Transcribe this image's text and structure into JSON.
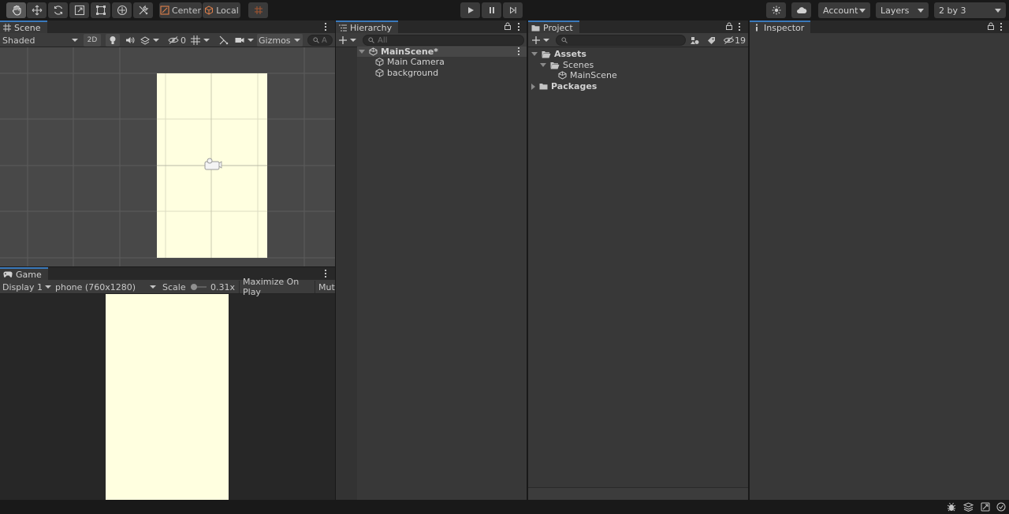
{
  "toolbar": {
    "pivot_label": "Center",
    "space_label": "Local",
    "account_label": "Account",
    "layers_label": "Layers",
    "layout_label": "2 by 3"
  },
  "scene": {
    "tab_label": "Scene",
    "shading_mode": "Shaded",
    "mode_2d_label": "2D",
    "hidden_count": "0",
    "gizmos_label": "Gizmos",
    "search_placeholder": "A"
  },
  "game": {
    "tab_label": "Game",
    "display_label": "Display 1",
    "resolution_label": "phone (760x1280)",
    "scale_label": "Scale",
    "scale_value": "0.31x",
    "maximize_label": "Maximize On Play",
    "mute_label": "Mute"
  },
  "hierarchy": {
    "tab_label": "Hierarchy",
    "search_placeholder": "All",
    "scene_name": "MainScene*",
    "items": [
      {
        "label": "Main Camera"
      },
      {
        "label": "background"
      }
    ]
  },
  "project": {
    "tab_label": "Project",
    "hidden_packages_count": "19",
    "tree": {
      "assets": "Assets",
      "scenes": "Scenes",
      "main_scene": "MainScene",
      "packages": "Packages"
    }
  },
  "inspector": {
    "tab_label": "Inspector"
  },
  "colors": {
    "camera_background": "#ffffe0",
    "tab_accent": "#3a79bb",
    "panel_background": "#383838"
  }
}
